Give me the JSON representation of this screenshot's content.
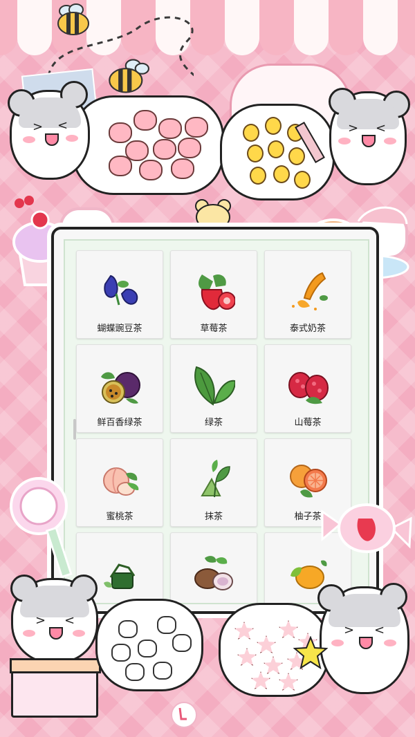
{
  "menu": {
    "items": [
      {
        "label": "蝴蝶豌豆茶",
        "icon": "butterfly-pea-icon"
      },
      {
        "label": "草莓茶",
        "icon": "strawberry-icon"
      },
      {
        "label": "泰式奶茶",
        "icon": "thai-milk-tea-icon"
      },
      {
        "label": "鲜百香绿茶",
        "icon": "passion-fruit-icon"
      },
      {
        "label": "绿茶",
        "icon": "green-tea-leaf-icon"
      },
      {
        "label": "山莓茶",
        "icon": "raspberry-icon"
      },
      {
        "label": "蜜桃茶",
        "icon": "peach-icon"
      },
      {
        "label": "抹茶",
        "icon": "matcha-icon"
      },
      {
        "label": "柚子茶",
        "icon": "grapefruit-icon"
      },
      {
        "label": "",
        "icon": "tea-herb-icon"
      },
      {
        "label": "",
        "icon": "taro-icon"
      },
      {
        "label": "",
        "icon": "mango-icon"
      }
    ]
  },
  "colors": {
    "background": "#f4adc1",
    "awning_pink": "#f7b5c4",
    "panel": "#f7f7f7",
    "card": "#f6f6f6"
  }
}
